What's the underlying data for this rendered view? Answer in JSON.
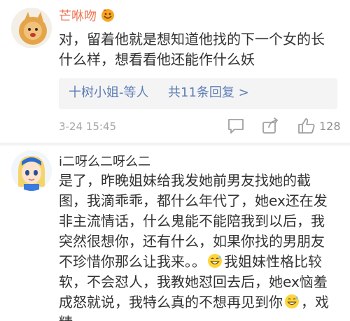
{
  "comments": [
    {
      "username": "芒咻吻",
      "badge_icon": "vip-badge-icon",
      "lines": [
        "对，留着他就是想知道他找的下一个女的长",
        "什么样，想看看他还能作什么妖"
      ],
      "replies": {
        "who": "十树小姐-等人",
        "count": "共11条回复 >"
      },
      "timestamp": "3-24 15:45",
      "likes": "128"
    },
    {
      "username": "i二呀么二呀么二",
      "lines": [
        "是了，昨晚姐妹给我发她前男友找她的截",
        "图，我滴乖乖，都什么年代了，她ex还在发",
        "非主流情话，什么鬼能不能陪我到以后，我",
        "突然很想你，还有什么，如果你找的男朋友",
        "不珍惜你那么让我来。。",
        "我姐妹性格比较",
        "软，不会怼人，我教她怼回去后，她ex恼羞",
        "成怒就说，我特么真的不想再见到你",
        "，戏",
        "精"
      ]
    }
  ],
  "colors": {
    "username_accent": "#eb7350",
    "link_blue": "#5d7db5",
    "meta_gray": "#a8a8a8",
    "reply_bg": "#f4f4f4"
  }
}
